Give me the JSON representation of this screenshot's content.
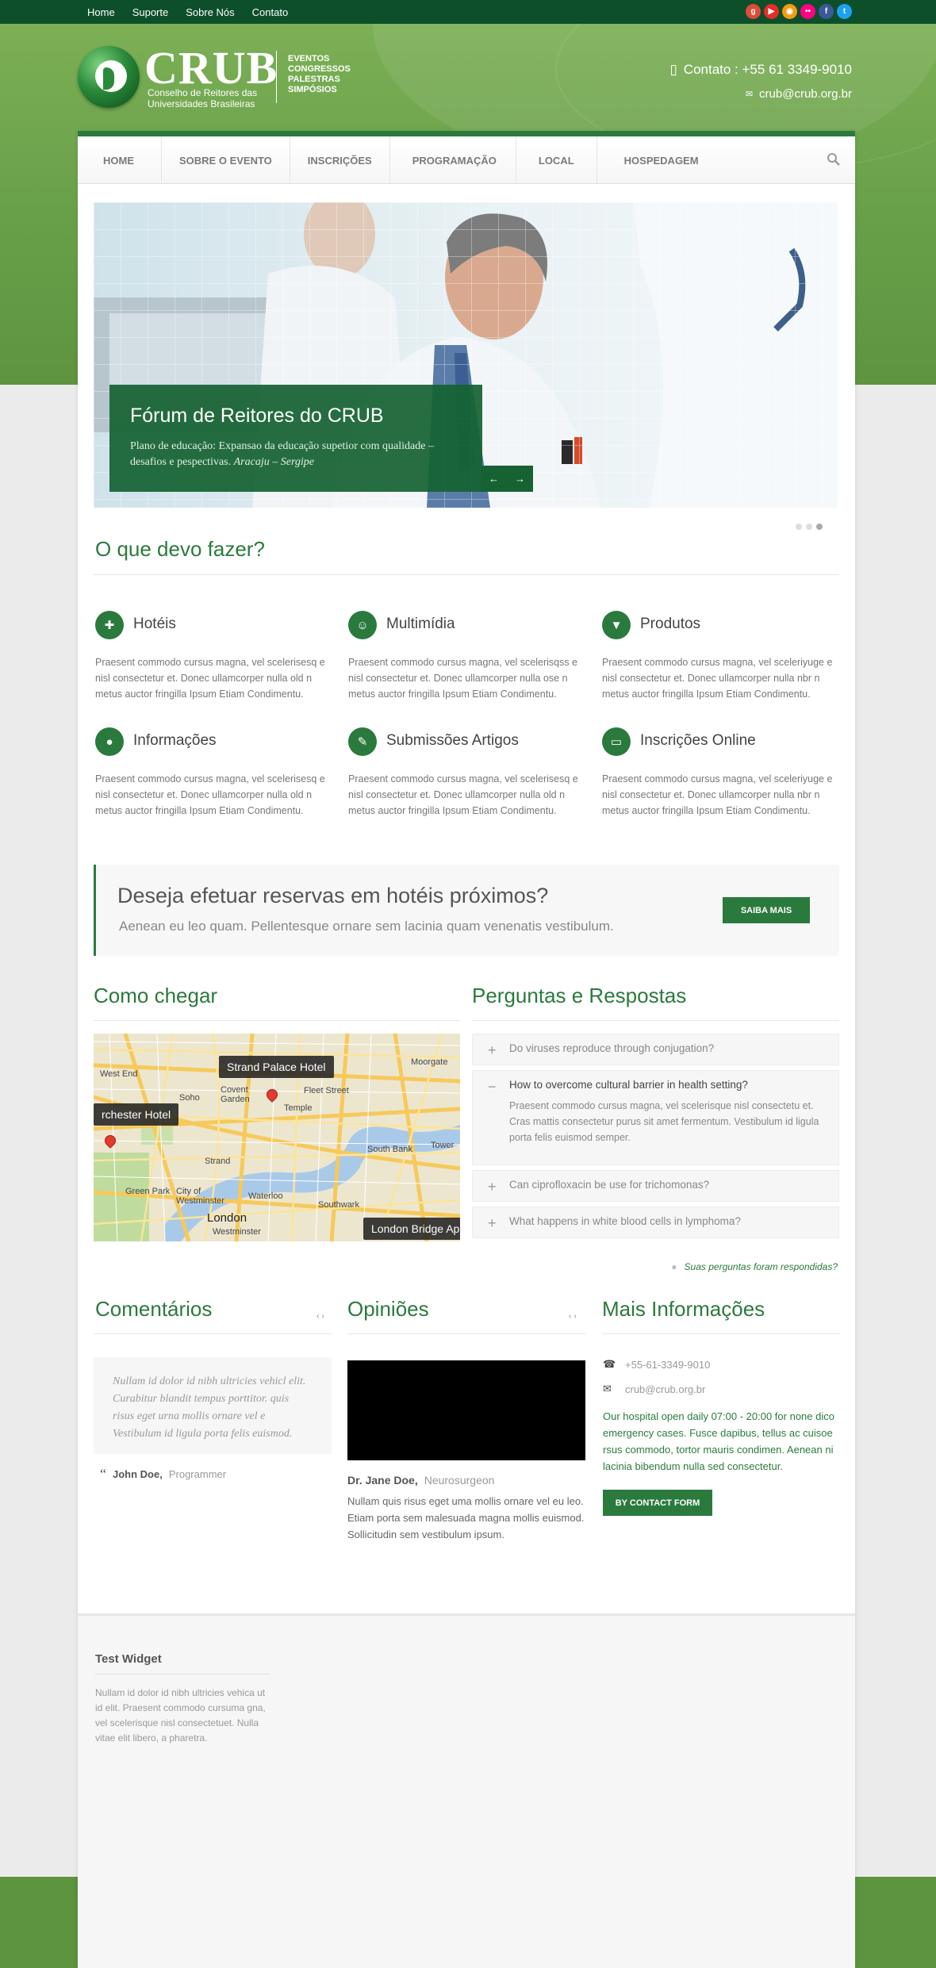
{
  "topbar": {
    "links": [
      "Home",
      "Suporte",
      "Sobre Nós",
      "Contato"
    ],
    "social": [
      {
        "name": "google-plus-icon",
        "glyph": "g",
        "color": "#dd4b39"
      },
      {
        "name": "youtube-icon",
        "glyph": "▶",
        "color": "#e52d27"
      },
      {
        "name": "rss-icon",
        "glyph": "◉",
        "color": "#f39c12"
      },
      {
        "name": "flickr-icon",
        "glyph": "••",
        "color": "#ff0084"
      },
      {
        "name": "facebook-icon",
        "glyph": "f",
        "color": "#3b5998"
      },
      {
        "name": "twitter-icon",
        "glyph": "t",
        "color": "#1da1f2"
      }
    ]
  },
  "logo": {
    "word": "CRUB",
    "sub1": "Conselho de Reitores das",
    "sub2": "Universidades  Brasileiras",
    "tags": [
      "EVENTOS",
      "CONGRESSOS",
      "PALESTRAS",
      "SIMPÓSIOS"
    ]
  },
  "contact": {
    "phone": "Contato : +55 61 3349-9010",
    "email": "crub@crub.org.br"
  },
  "menu": [
    "HOME",
    "SOBRE O EVENTO",
    "INSCRIÇÕES",
    "PROGRAMAÇÃO",
    "LOCAL",
    "HOSPEDAGEM"
  ],
  "slider": {
    "title": "Fórum de Reitores do CRUB",
    "text": "Plano de educação: Expansao da educação supetior com qualidade – desafios e pespectivas.",
    "place": "Aracaju – Sergipe",
    "prev": "←",
    "next": "→",
    "dots": 3,
    "active_dot": 3
  },
  "what_to_do": {
    "title": "O que devo fazer?",
    "items": [
      {
        "title": "Hotéis",
        "icon": "hotel-icon",
        "text": "Praesent commodo cursus magna, vel scelerisesq e nisl consectetur et. Donec ullamcorper nulla old n metus auctor fringilla Ipsum Etiam Condimentu."
      },
      {
        "title": "Multimídia",
        "icon": "multimedia-icon",
        "text": "Praesent commodo cursus magna, vel scelerisqss e nisl consectetur et. Donec ullamcorper nulla ose n metus auctor fringilla Ipsum Etiam Condimentu."
      },
      {
        "title": "Produtos",
        "icon": "tshirt-icon",
        "text": "Praesent commodo cursus magna, vel sceleriyuge e nisl consectetur et. Donec ullamcorper nulla nbr n metus auctor fringilla Ipsum Etiam Condimentu."
      },
      {
        "title": "Informações",
        "icon": "lightbulb-icon",
        "text": "Praesent commodo cursus magna, vel scelerisesq e nisl consectetur et. Donec ullamcorper nulla old n metus auctor fringilla Ipsum Etiam Condimentu."
      },
      {
        "title": "Submissões Artigos",
        "icon": "pencil-icon",
        "text": "Praesent commodo cursus magna, vel scelerisesq e nisl consectetur et. Donec ullamcorper nulla old n metus auctor fringilla Ipsum Etiam Condimentu."
      },
      {
        "title": "Inscrições Online",
        "icon": "ticket-icon",
        "text": "Praesent commodo cursus magna, vel sceleriyuge e nisl consectetur et. Donec ullamcorper nulla nbr n metus auctor fringilla Ipsum Etiam Condimentu."
      }
    ]
  },
  "cta": {
    "title": "Deseja efetuar reservas em hotéis próximos?",
    "text": "Aenean eu leo quam. Pellentesque ornare sem lacinia quam venenatis vestibulum.",
    "button": "SAIBA MAIS"
  },
  "directions": {
    "title": "Como chegar",
    "labels": [
      "Strand Palace Hotel",
      "rchester Hotel",
      "London Bridge Ap"
    ],
    "places": [
      "West End",
      "Moorgate",
      "Soho",
      "Covent Garden",
      "Fleet Street",
      "Temple",
      "Strand",
      "South Bank",
      "Tower",
      "Green Park",
      "City of Westminster",
      "Waterloo",
      "Southwark",
      "London",
      "Westminster"
    ]
  },
  "faq": {
    "title": "Perguntas e Respostas",
    "items": [
      {
        "q": "Do viruses reproduce through conjugation?",
        "open": false
      },
      {
        "q": "How to overcome cultural barrier in health setting?",
        "open": true,
        "a": "Praesent commodo cursus magna, vel scelerisque nisl consectetu et. Cras mattis consectetur purus sit amet fermentum. Vestibulum id ligula porta felis euismod semper."
      },
      {
        "q": "Can ciprofloxacin be use for trichomonas?",
        "open": false
      },
      {
        "q": "What happens in white blood cells in lymphoma?",
        "open": false
      }
    ],
    "link": "Suas perguntas foram respondidas?"
  },
  "comments": {
    "title": "Comentários",
    "quote": "Nullam id dolor id nibh ultricies vehicl elit. Curabitur blandit tempus porttitor. quis risus eget urna mollis ornare vel e Vestibulum id ligula porta felis euismod.",
    "author": "John Doe,",
    "role": "Programmer"
  },
  "opinions": {
    "title": "Opiniões",
    "author": "Dr. Jane Doe,",
    "role": "Neurosurgeon",
    "text": "Nullam quis risus eget uma mollis ornare vel eu leo. Etiam porta sem malesuada magna mollis euismod. Sollicitudin sem vestibulum ipsum."
  },
  "more_info": {
    "title": "Mais Informações",
    "phone": "+55-61-3349-9010",
    "email": "crub@crub.org.br",
    "text": "Our hospital open daily 07:00 - 20:00 for none dico emergency cases. Fusce dapibus, tellus ac cuisoe rsus commodo, tortor mauris condimen. Aenean ni lacinia bibendum nulla sed consectetur.",
    "button": "BY CONTACT FORM"
  },
  "footer": {
    "widget_title": "Test Widget",
    "widget_text": "Nullam id dolor id nibh ultricies vehica ut id elit. Praesent commodo cursuma gna, vel scelerisque nisl consectetuet. Nulla vitae elit libero, a pharetra."
  }
}
